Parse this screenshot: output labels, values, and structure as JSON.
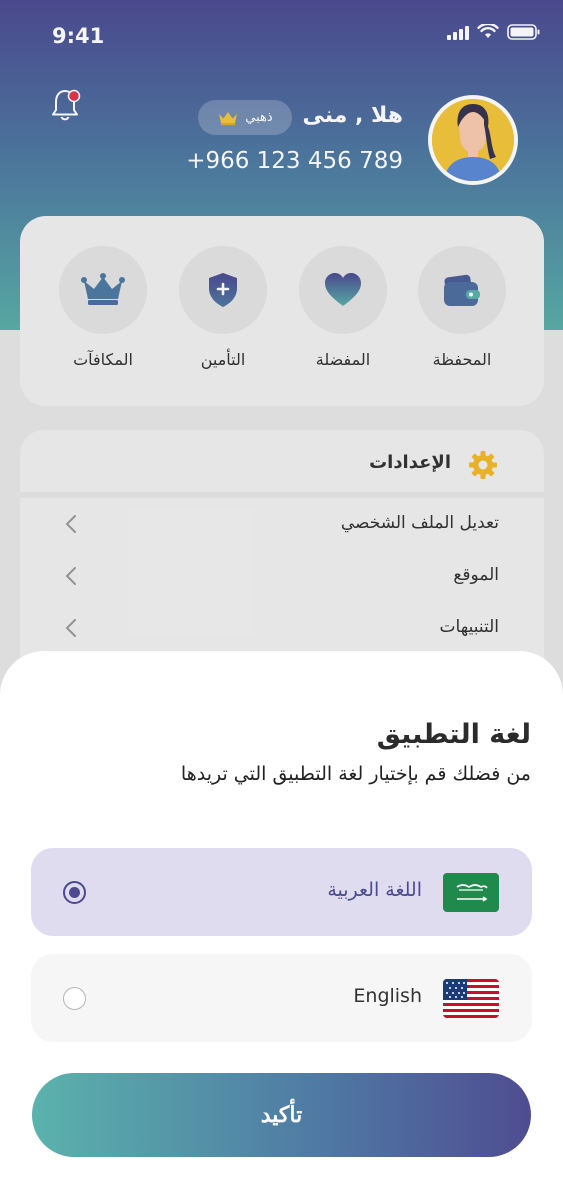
{
  "status_bar": {
    "time": "9:41"
  },
  "profile": {
    "greeting": "هلا , منى",
    "tier": "ذهبي",
    "phone": "+966 123 456 789"
  },
  "quick_actions": [
    {
      "label": "المحفظة",
      "icon": "wallet-icon"
    },
    {
      "label": "المفضلة",
      "icon": "heart-icon"
    },
    {
      "label": "التأمين",
      "icon": "shield-plus-icon"
    },
    {
      "label": "المكافآت",
      "icon": "crown-icon"
    }
  ],
  "settings": {
    "title": "الإعدادات",
    "items": [
      {
        "label": "تعديل الملف الشخصي"
      },
      {
        "label": "الموقع"
      },
      {
        "label": "التنبيهات"
      }
    ]
  },
  "language_sheet": {
    "title": "لغة التطبيق",
    "subtitle": "من فضلك قم بإختيار لغة التطبيق التي تريدها",
    "options": [
      {
        "label": "اللغة العربية",
        "flag": "saudi-flag-icon",
        "selected": true
      },
      {
        "label": "English",
        "flag": "us-flag-icon",
        "selected": false
      }
    ],
    "confirm_label": "تأكيد"
  },
  "colors": {
    "primary": "#4f4c91",
    "teal": "#5bb2ac",
    "gold": "#f2c53d",
    "selected_bg": "#dedcee"
  }
}
